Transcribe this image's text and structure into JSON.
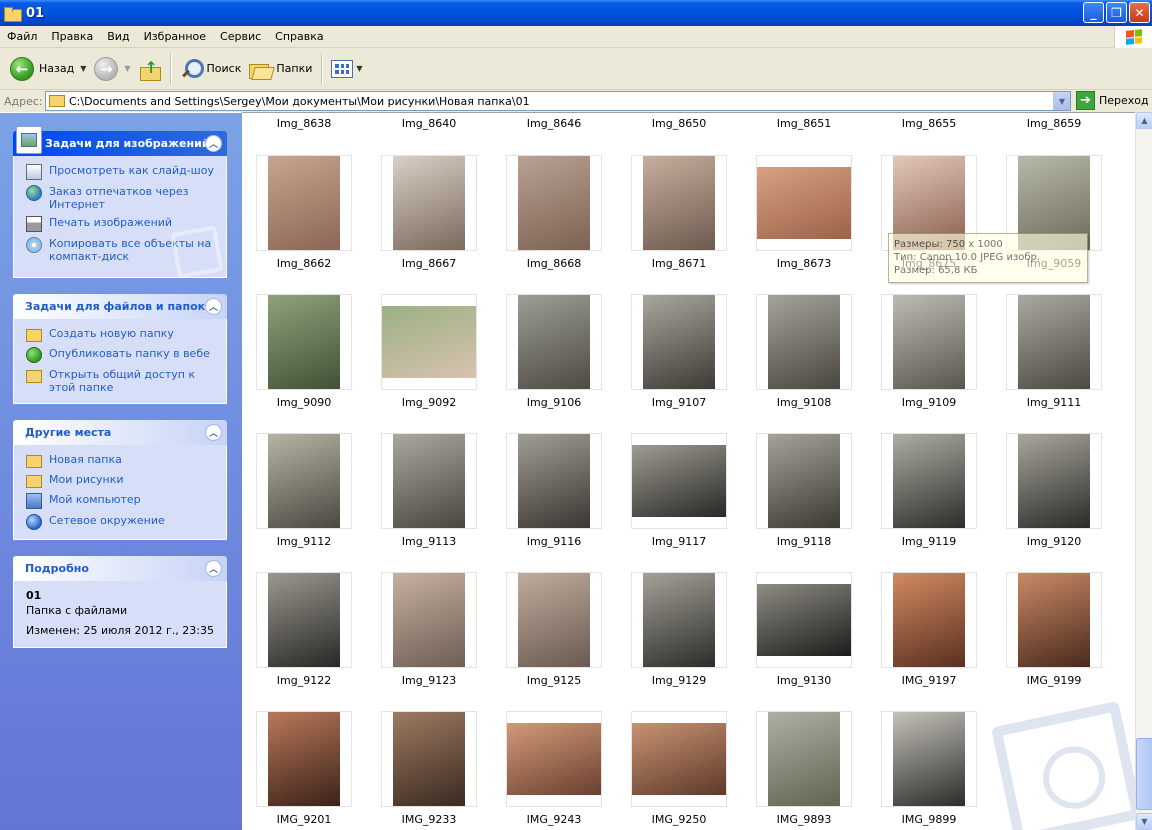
{
  "window": {
    "title": "01"
  },
  "menu": [
    "Файл",
    "Правка",
    "Вид",
    "Избранное",
    "Сервис",
    "Справка"
  ],
  "toolbar": {
    "back": "Назад",
    "search": "Поиск",
    "folders": "Папки"
  },
  "address": {
    "label": "Адрес:",
    "path": "C:\\Documents and Settings\\Sergey\\Мои документы\\Мои рисунки\\Новая папка\\01",
    "go": "Переход"
  },
  "panels": {
    "image_tasks": {
      "title": "Задачи для изображений",
      "items": [
        "Просмотреть как слайд-шоу",
        "Заказ отпечатков через Интернет",
        "Печать изображений",
        "Копировать все объекты на компакт-диск"
      ]
    },
    "file_tasks": {
      "title": "Задачи для файлов и папок",
      "items": [
        "Создать новую папку",
        "Опубликовать папку в вебе",
        "Открыть общий доступ к этой папке"
      ]
    },
    "other_places": {
      "title": "Другие места",
      "items": [
        "Новая папка",
        "Мои рисунки",
        "Мой компьютер",
        "Сетевое окружение"
      ]
    },
    "details": {
      "title": "Подробно",
      "name": "01",
      "type": "Папка с файлами",
      "modified": "Изменен: 25 июля 2012 г., 23:35"
    }
  },
  "top_captions": [
    "Img_8638",
    "Img_8640",
    "Img_8646",
    "Img_8650",
    "Img_8651",
    "Img_8655",
    "Img_8659"
  ],
  "rows": [
    [
      {
        "name": "Img_8662",
        "orient": "p",
        "c1": "#C9A48E",
        "c2": "#8A6656"
      },
      {
        "name": "Img_8667",
        "orient": "p",
        "c1": "#D9CFC4",
        "c2": "#7A6A5E"
      },
      {
        "name": "Img_8668",
        "orient": "p",
        "c1": "#B8A294",
        "c2": "#7C6252"
      },
      {
        "name": "Img_8671",
        "orient": "p",
        "c1": "#C7AE9D",
        "c2": "#6D5A4F"
      },
      {
        "name": "Img_8673",
        "orient": "l",
        "c1": "#D8A182",
        "c2": "#9C6248"
      },
      {
        "name": "Img_8675",
        "orient": "p",
        "c1": "#E2C8BA",
        "c2": "#8A5E4E"
      },
      {
        "name": "Img_9059",
        "orient": "p",
        "c1": "#B7B9A8",
        "c2": "#6E6A58"
      }
    ],
    [
      {
        "name": "Img_9090",
        "orient": "p",
        "c1": "#8FA27C",
        "c2": "#3F5236"
      },
      {
        "name": "Img_9092",
        "orient": "l",
        "c1": "#9BB084",
        "c2": "#D8C2B0"
      },
      {
        "name": "Img_9106",
        "orient": "p",
        "c1": "#9C9E94",
        "c2": "#4E4A44"
      },
      {
        "name": "Img_9107",
        "orient": "p",
        "c1": "#A8A79C",
        "c2": "#3E3A36"
      },
      {
        "name": "Img_9108",
        "orient": "p",
        "c1": "#A5A399",
        "c2": "#4A4640"
      },
      {
        "name": "Img_9109",
        "orient": "p",
        "c1": "#BDBCB2",
        "c2": "#5A564E"
      },
      {
        "name": "Img_9111",
        "orient": "p",
        "c1": "#ABA99F",
        "c2": "#4C4842"
      }
    ],
    [
      {
        "name": "Img_9112",
        "orient": "p",
        "c1": "#B6B3A6",
        "c2": "#4C4840"
      },
      {
        "name": "Img_9113",
        "orient": "p",
        "c1": "#A9A89E",
        "c2": "#4A463F"
      },
      {
        "name": "Img_9116",
        "orient": "p",
        "c1": "#A09E94",
        "c2": "#3A3632"
      },
      {
        "name": "Img_9117",
        "orient": "l",
        "c1": "#9E9C92",
        "c2": "#2A2826"
      },
      {
        "name": "Img_9118",
        "orient": "p",
        "c1": "#A4A398",
        "c2": "#3C3934"
      },
      {
        "name": "Img_9119",
        "orient": "p",
        "c1": "#AEAEA4",
        "c2": "#2E2C2A"
      },
      {
        "name": "Img_9120",
        "orient": "p",
        "c1": "#A8A79D",
        "c2": "#2C2A28"
      }
    ],
    [
      {
        "name": "Img_9122",
        "orient": "p",
        "c1": "#9A988E",
        "c2": "#2A2826"
      },
      {
        "name": "Img_9123",
        "orient": "p",
        "c1": "#C7B0A0",
        "c2": "#6E5E54"
      },
      {
        "name": "Img_9125",
        "orient": "p",
        "c1": "#C0AC9E",
        "c2": "#6A5A50"
      },
      {
        "name": "Img_9129",
        "orient": "p",
        "c1": "#A3A197",
        "c2": "#2E2C2A"
      },
      {
        "name": "Img_9130",
        "orient": "l",
        "c1": "#8E8C84",
        "c2": "#1E1C1A"
      },
      {
        "name": "IMG_9197",
        "orient": "p",
        "c1": "#D28A62",
        "c2": "#5A3020"
      },
      {
        "name": "IMG_9199",
        "orient": "p",
        "c1": "#C98A66",
        "c2": "#4A2A1C"
      }
    ],
    [
      {
        "name": "IMG_9201",
        "orient": "p",
        "c1": "#B9785A",
        "c2": "#3A2218"
      },
      {
        "name": "IMG_9233",
        "orient": "p",
        "c1": "#9E7A62",
        "c2": "#3A2A20"
      },
      {
        "name": "IMG_9243",
        "orient": "l",
        "c1": "#D29A78",
        "c2": "#6A4030"
      },
      {
        "name": "IMG_9250",
        "orient": "l",
        "c1": "#C99272",
        "c2": "#5E3A2A"
      },
      {
        "name": "IMG_9893",
        "orient": "p",
        "c1": "#B0AEA4",
        "c2": "#5E6650"
      },
      {
        "name": "IMG_9899",
        "orient": "p",
        "c1": "#C4C2BA",
        "c2": "#2E2C2A"
      }
    ]
  ],
  "tooltip": {
    "size": "Размеры: 750 x 1000",
    "type": "Тип: Canon 10.0 JPEG изобр.",
    "filesize": "Размер: 65,8 КБ"
  },
  "colors": {
    "title_bar": "#0054E3",
    "left_pane_top": "#7BA2E7",
    "left_pane_bottom": "#6375D6",
    "link": "#215DC6"
  }
}
